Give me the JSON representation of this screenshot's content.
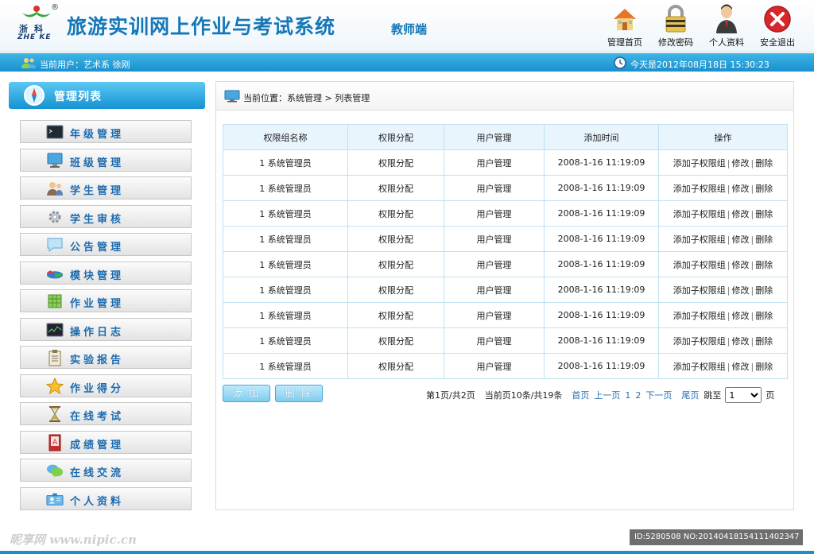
{
  "header": {
    "logo_reg": "®",
    "logo_cn": "浙科",
    "logo_en": "ZHE KE",
    "title": "旅游实训网上作业与考试系统",
    "subtitle": "教师端",
    "nav": [
      {
        "label": "管理首页",
        "icon": "home-icon"
      },
      {
        "label": "修改密码",
        "icon": "lock-icon"
      },
      {
        "label": "个人资料",
        "icon": "person-icon"
      },
      {
        "label": "安全退出",
        "icon": "exit-icon"
      }
    ]
  },
  "status": {
    "user": "当前用户：艺术系  徐刚",
    "date": "今天是2012年08月18日  15:30:23"
  },
  "sidebar": {
    "title": "管理列表",
    "items": [
      {
        "label": "年级管理",
        "icon": "terminal-icon"
      },
      {
        "label": "班级管理",
        "icon": "computer-icon"
      },
      {
        "label": "学生管理",
        "icon": "users-icon"
      },
      {
        "label": "学生审核",
        "icon": "gear-icon"
      },
      {
        "label": "公告管理",
        "icon": "speech-bubble-icon"
      },
      {
        "label": "模块管理",
        "icon": "pie-chart-icon"
      },
      {
        "label": "作业管理",
        "icon": "spreadsheet-icon"
      },
      {
        "label": "操作日志",
        "icon": "monitor-chart-icon"
      },
      {
        "label": "实验报告",
        "icon": "clipboard-icon"
      },
      {
        "label": "作业得分",
        "icon": "star-icon"
      },
      {
        "label": "在线考试",
        "icon": "hourglass-icon"
      },
      {
        "label": "成绩管理",
        "icon": "book-icon"
      },
      {
        "label": "在线交流",
        "icon": "chat-icon"
      },
      {
        "label": "个人资料",
        "icon": "id-card-icon"
      }
    ]
  },
  "main": {
    "breadcrumb": "当前位置：系统管理 > 列表管理",
    "table": {
      "headers": [
        "权限组名称",
        "权限分配",
        "用户管理",
        "添加时间",
        "操作"
      ],
      "rows": [
        [
          "1 系统管理员",
          "权限分配",
          "用户管理",
          "2008-1-16 11:19:09"
        ],
        [
          "1 系统管理员",
          "权限分配",
          "用户管理",
          "2008-1-16 11:19:09"
        ],
        [
          "1 系统管理员",
          "权限分配",
          "用户管理",
          "2008-1-16 11:19:09"
        ],
        [
          "1 系统管理员",
          "权限分配",
          "用户管理",
          "2008-1-16 11:19:09"
        ],
        [
          "1 系统管理员",
          "权限分配",
          "用户管理",
          "2008-1-16 11:19:09"
        ],
        [
          "1 系统管理员",
          "权限分配",
          "用户管理",
          "2008-1-16 11:19:09"
        ],
        [
          "1 系统管理员",
          "权限分配",
          "用户管理",
          "2008-1-16 11:19:09"
        ],
        [
          "1 系统管理员",
          "权限分配",
          "用户管理",
          "2008-1-16 11:19:09"
        ],
        [
          "1 系统管理员",
          "权限分配",
          "用户管理",
          "2008-1-16 11:19:09"
        ]
      ],
      "actions": {
        "add_child": "添加子权限组",
        "edit": "修改",
        "delete": "删除",
        "sep": "|"
      }
    },
    "buttons": {
      "add": "添加",
      "delete": "删除"
    },
    "pager": {
      "page_info": "第1页/共2页",
      "count_info": "当前页10条/共19条",
      "first": "首页",
      "prev": "上一页",
      "p1": "1",
      "p2": "2",
      "next": "下一页",
      "last": "尾页",
      "jump": "跳至",
      "selected": "1",
      "page_unit": "页"
    }
  },
  "watermark": {
    "left": "昵享网 www.nipic.cn",
    "right": "ID:5280508 NO:20140418154111402347"
  }
}
